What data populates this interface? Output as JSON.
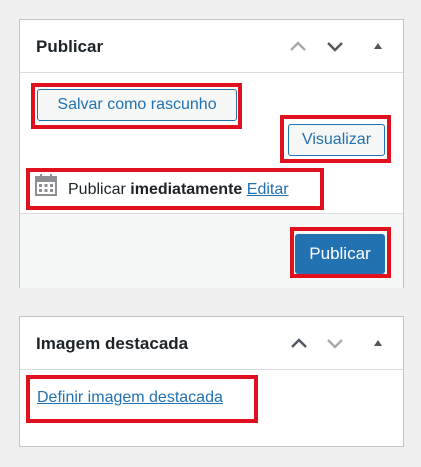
{
  "publish_box": {
    "title": "Publicar",
    "save_draft_label": "Salvar como rascunho",
    "preview_label": "Visualizar",
    "publish_status_prefix": "Publicar",
    "publish_status_value": "imediatamente",
    "edit_link_label": "Editar",
    "publish_button_label": "Publicar"
  },
  "featured_box": {
    "title": "Imagem destacada",
    "set_image_link_label": "Definir imagem destacada"
  },
  "colors": {
    "highlight": "#e0101e",
    "accent": "#2271b1",
    "panel_border": "#c3c4c7",
    "background": "#f0f0f1"
  },
  "icons": {
    "move_up": "chevron-up-icon",
    "move_down": "chevron-down-icon",
    "toggle": "triangle-up-icon",
    "calendar": "calendar-icon"
  }
}
